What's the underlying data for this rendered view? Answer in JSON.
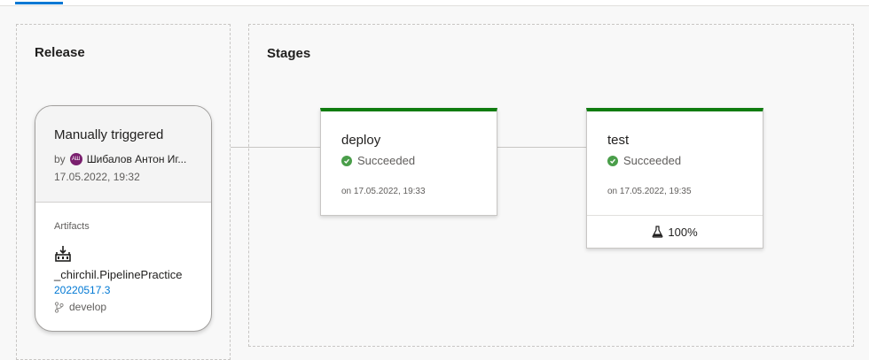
{
  "release_panel": {
    "title": "Release",
    "trigger_title": "Manually triggered",
    "by_label": "by",
    "avatar_initials": "АШ",
    "user_name": "Шибалов Антон Иг...",
    "trigger_date": "17.05.2022, 19:32",
    "artifacts_label": "Artifacts",
    "artifact": {
      "icon": "build-artifact-icon",
      "name": "_chirchil.PipelinePractice",
      "version": "20220517.3",
      "branch_icon": "git-branch-icon",
      "branch": "develop"
    }
  },
  "stages_panel": {
    "title": "Stages",
    "stages": [
      {
        "name": "deploy",
        "status": "Succeeded",
        "status_icon": "success-check-icon",
        "date": "on 17.05.2022, 19:33"
      },
      {
        "name": "test",
        "status": "Succeeded",
        "status_icon": "success-check-icon",
        "date": "on 17.05.2022, 19:35",
        "test_icon": "flask-icon",
        "test_pass_rate": "100%"
      }
    ]
  },
  "colors": {
    "success": "#107c10",
    "accent": "#0078d4",
    "avatar": "#7a1f6e"
  }
}
